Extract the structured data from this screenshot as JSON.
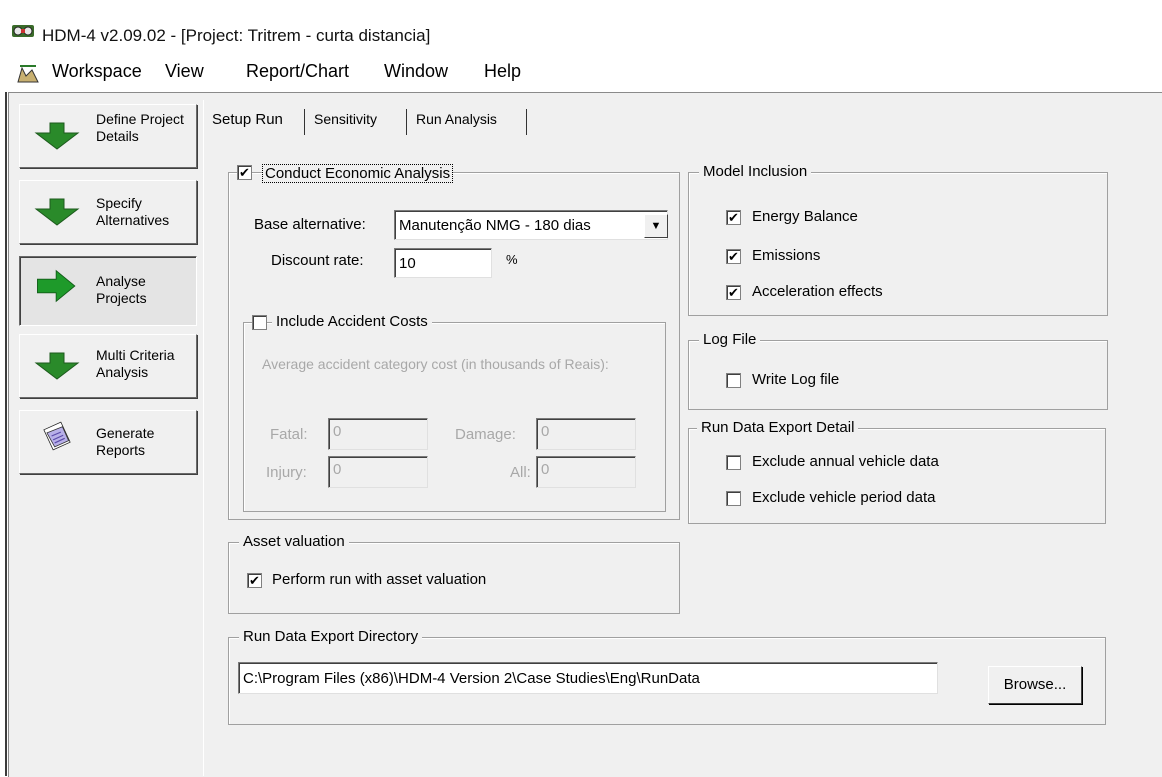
{
  "window": {
    "title": "HDM-4 v2.09.02 - [Project: Tritrem - curta distancia]"
  },
  "menu": {
    "workspace": "Workspace",
    "view": "View",
    "report_chart": "Report/Chart",
    "window": "Window",
    "help": "Help"
  },
  "nav": {
    "define": "Define Project Details",
    "specify": "Specify Alternatives",
    "analyse": "Analyse Projects",
    "multi": "Multi Criteria Analysis",
    "generate": "Generate Reports"
  },
  "tabs": {
    "setup_run": "Setup Run",
    "sensitivity": "Sensitivity",
    "run_analysis": "Run Analysis"
  },
  "economic": {
    "title": "Conduct Economic Analysis",
    "checked": true,
    "base_alt_label": "Base alternative:",
    "base_alt_value": "Manutenção NMG - 180 dias",
    "discount_label": "Discount rate:",
    "discount_value": "10",
    "percent": "%"
  },
  "accident": {
    "title": "Include Accident Costs",
    "checked": false,
    "desc": "Average accident category cost (in thousands of Reais):",
    "fatal_label": "Fatal:",
    "fatal_value": "0",
    "damage_label": "Damage:",
    "damage_value": "0",
    "injury_label": "Injury:",
    "injury_value": "0",
    "all_label": "All:",
    "all_value": "0"
  },
  "asset": {
    "title": "Asset valuation",
    "option": "Perform run with asset valuation",
    "checked": true
  },
  "model_inclusion": {
    "title": "Model Inclusion",
    "energy": "Energy Balance",
    "emissions": "Emissions",
    "acceleration": "Acceleration effects"
  },
  "log_file": {
    "title": "Log File",
    "write": "Write Log file",
    "checked": false
  },
  "export_detail": {
    "title": "Run Data Export Detail",
    "annual": "Exclude annual vehicle data",
    "period": "Exclude vehicle period data"
  },
  "export_dir": {
    "title": "Run Data Export Directory",
    "path": "C:\\Program Files (x86)\\HDM-4 Version 2\\Case Studies\\Eng\\RunData",
    "browse": "Browse..."
  },
  "check_mark": "✔"
}
